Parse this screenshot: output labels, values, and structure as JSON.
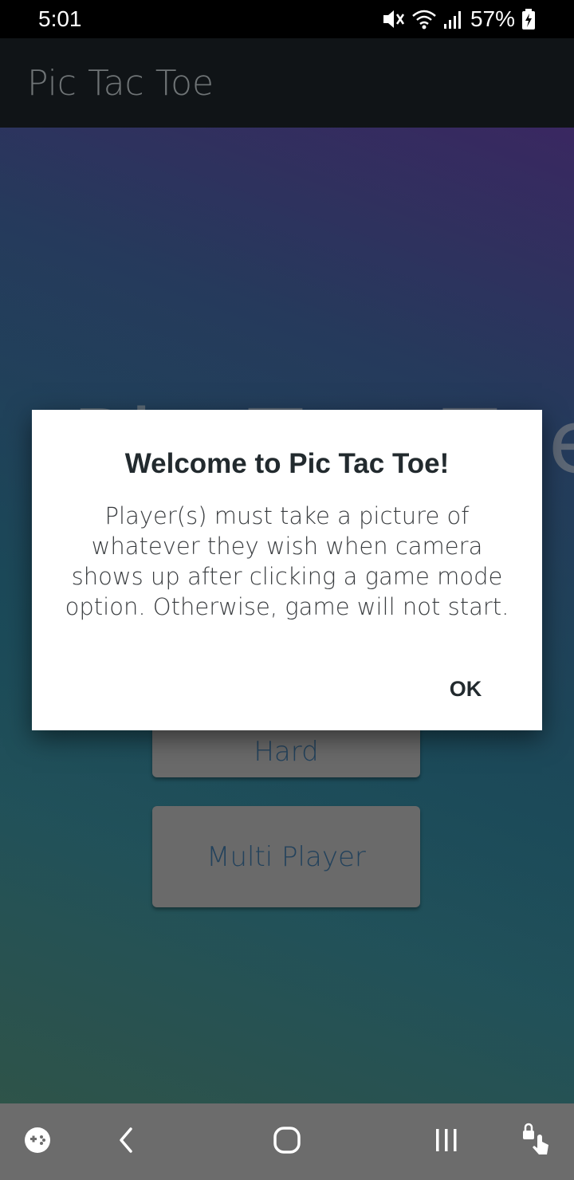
{
  "status_bar": {
    "time": "5:01",
    "battery": "57%",
    "icons": [
      "mute-icon",
      "wifi-icon",
      "signal-icon",
      "battery-charging-icon"
    ]
  },
  "app_bar": {
    "title": "Pic Tac Toe"
  },
  "background_screen": {
    "big_title": "Pic Tac Toe",
    "buttons": [
      {
        "label": "Hard"
      },
      {
        "label": "Multi Player"
      }
    ]
  },
  "dialog": {
    "title": "Welcome to Pic Tac Toe!",
    "message": "Player(s) must take a picture of whatever they wish when camera shows up after clicking a game mode option. Otherwise, game will not start.",
    "ok_label": "OK"
  },
  "nav_bar": {
    "icons": [
      "game-tools-icon",
      "back-icon",
      "home-icon",
      "recent-apps-icon",
      "touch-lock-icon"
    ]
  },
  "colors": {
    "status_bar_bg": "#000000",
    "app_bar_bg": "#101417",
    "dialog_bg": "#ffffff",
    "nav_bar_bg": "#6c6c6c",
    "button_text": "#23425c"
  }
}
